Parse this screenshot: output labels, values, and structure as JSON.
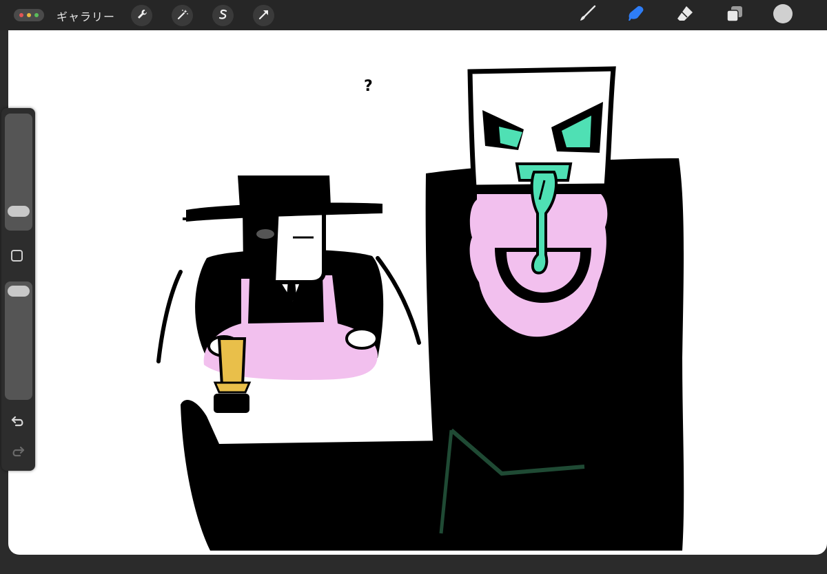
{
  "toolbar": {
    "gallery_label": "ギャラリー",
    "window_dots": [
      "#e25555",
      "#e8b840",
      "#5bbd5b"
    ],
    "left_tools": [
      {
        "name": "wrench-icon"
      },
      {
        "name": "magic-wand-icon"
      },
      {
        "name": "selection-s-icon"
      },
      {
        "name": "transform-arrow-icon"
      }
    ],
    "right_tools": [
      {
        "name": "brush-icon",
        "active": false
      },
      {
        "name": "smudge-icon",
        "active": true
      },
      {
        "name": "eraser-icon",
        "active": false
      },
      {
        "name": "layers-icon",
        "active": false
      },
      {
        "name": "color-swatch-icon",
        "color": "#d0d0d0"
      }
    ],
    "accent_color": "#2e7df6"
  },
  "sidebar": {
    "brush_size": 0.3,
    "opacity": 0.95,
    "undo_icon": "undo-icon",
    "redo_icon": "redo-icon",
    "modify_button": "square-modify-icon"
  },
  "canvas": {
    "question_mark": "?",
    "colors": {
      "black": "#000000",
      "pink": "#f2c0ee",
      "mint": "#4fe0b4",
      "gold": "#e9bf4a",
      "dark_green": "#1f4a34"
    }
  }
}
